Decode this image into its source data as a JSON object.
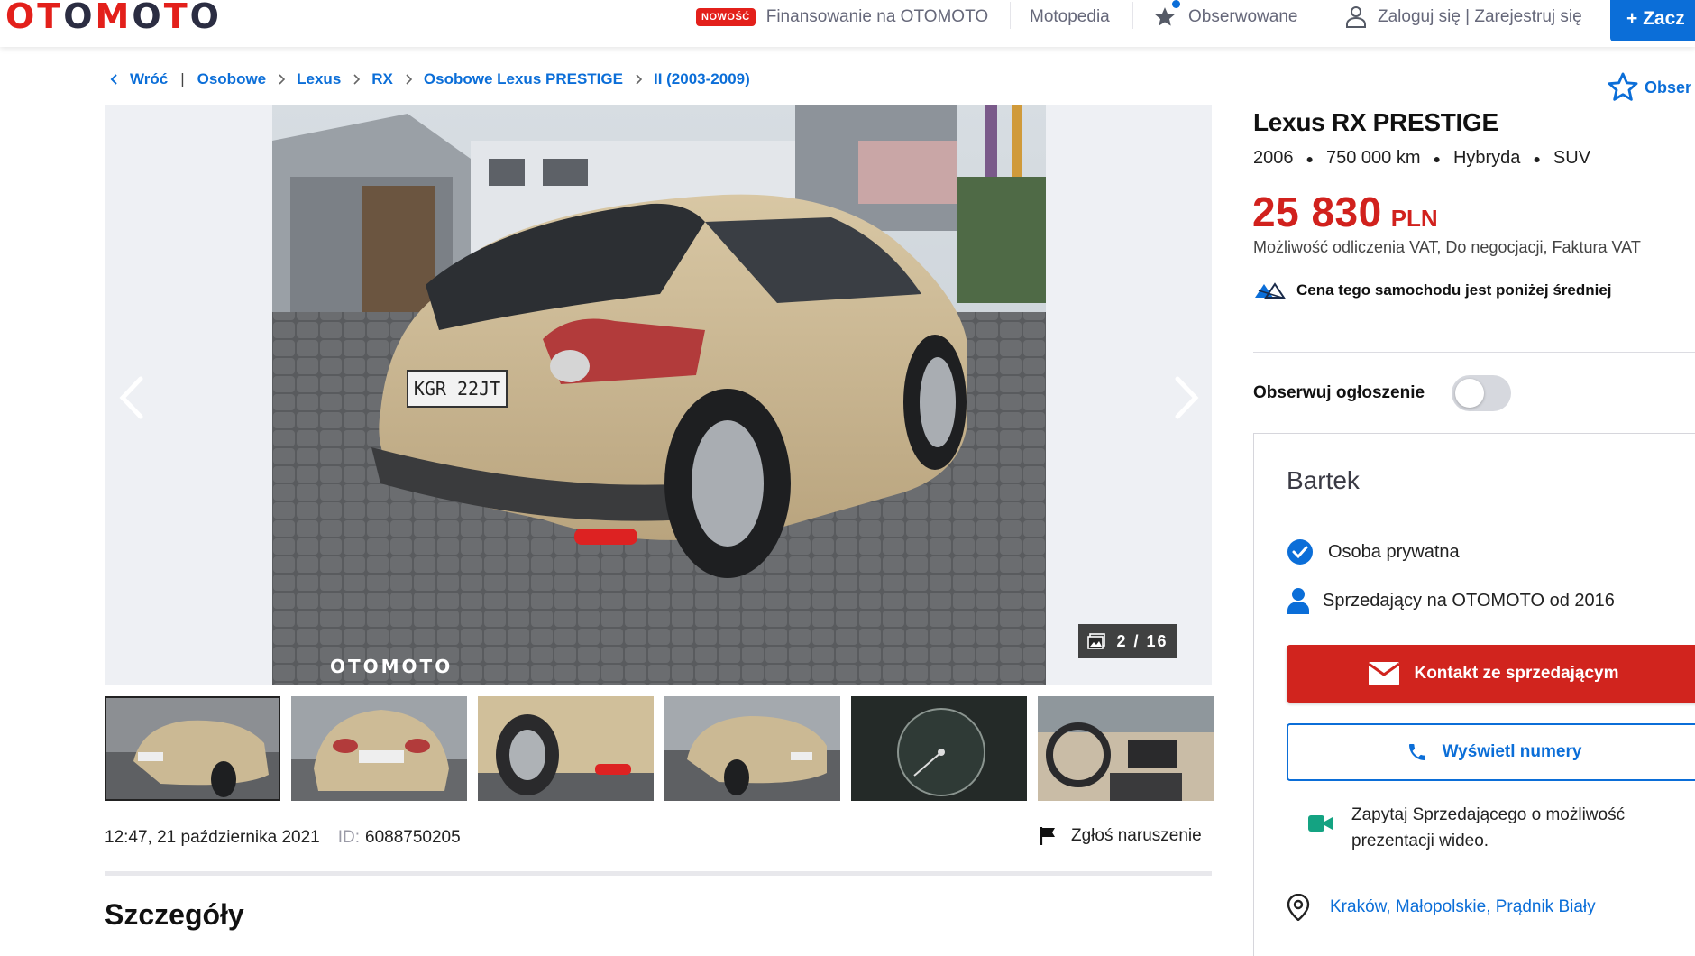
{
  "header": {
    "logo": "OTOMOTO",
    "new_badge": "NOWOŚĆ",
    "financing": "Finansowanie na OTOMOTO",
    "motopedia": "Motopedia",
    "watched": "Obserwowane",
    "login": "Zaloguj się | Zarejestruj się",
    "cta": "+ Zacz"
  },
  "breadcrumb": {
    "back": "Wróć",
    "items": [
      "Osobowe",
      "Lexus",
      "RX",
      "Osobowe Lexus PRESTIGE",
      "II (2003-2009)"
    ]
  },
  "follow_top": "Obser",
  "gallery": {
    "watermark": "OTOMOTO",
    "plate": "KGR 22JT",
    "counter": "2 / 16",
    "thumbnails": [
      "rear-left view",
      "rear view",
      "rear bumper",
      "rear-left view",
      "dashboard speedometer",
      "interior cockpit"
    ]
  },
  "meta": {
    "date": "12:47, 21 października 2021",
    "id_label": "ID:",
    "id_value": "6088750205",
    "report": "Zgłoś naruszenie"
  },
  "section_title": "Szczegóły",
  "listing": {
    "title": "Lexus RX PRESTIGE",
    "year": "2006",
    "mileage": "750 000 km",
    "fuel": "Hybryda",
    "body": "SUV",
    "price": "25 830",
    "currency": "PLN",
    "price_notes": "Możliwość odliczenia VAT, Do negocjacji, Faktura VAT",
    "price_indicator": "Cena tego samochodu jest poniżej średniej",
    "observe_label": "Obserwuj ogłoszenie"
  },
  "seller": {
    "name": "Bartek",
    "type": "Osoba prywatna",
    "since": "Sprzedający na OTOMOTO od 2016",
    "contact_button": "Kontakt ze sprzedającym",
    "phone_button": "Wyświetl numery",
    "video_line1": "Zapytaj Sprzedającego o możliwość",
    "video_line2": "prezentacji wideo.",
    "location": "Kraków, Małopolskie, Prądnik Biały"
  },
  "colors": {
    "brand_red": "#e3201b",
    "link_blue": "#0b6ed8",
    "price_red": "#d1211d",
    "video_green": "#14a382"
  }
}
